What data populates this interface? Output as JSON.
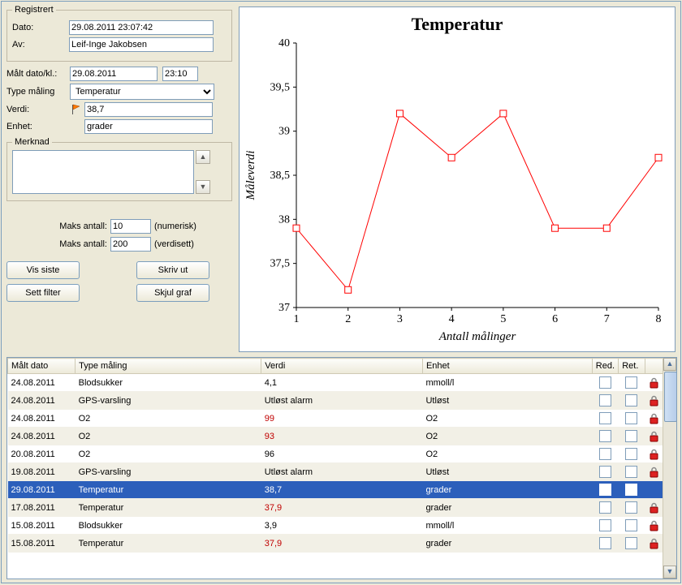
{
  "registered": {
    "legend": "Registrert",
    "date_label": "Dato:",
    "date_value": "29.08.2011 23:07:42",
    "by_label": "Av:",
    "by_value": "Leif-Inge Jakobsen"
  },
  "measure_form": {
    "measured_label": "Målt dato/kl.:",
    "measured_date": "29.08.2011",
    "measured_time": "23:10",
    "type_label": "Type måling",
    "type_value": "Temperatur",
    "value_label": "Verdi:",
    "value": "38,7",
    "unit_label": "Enhet:",
    "unit_value": "grader",
    "note_legend": "Merknad",
    "note_value": ""
  },
  "limits": {
    "label": "Maks antall:",
    "numeric_value": "10",
    "numeric_suffix": "(numerisk)",
    "valueset_value": "200",
    "valueset_suffix": "(verdisett)"
  },
  "buttons": {
    "vis_siste": "Vis siste",
    "sett_filter": "Sett filter",
    "skriv_ut": "Skriv ut",
    "skjul_graf": "Skjul graf"
  },
  "chart_data": {
    "type": "line",
    "title": "Temperatur",
    "xlabel": "Antall målinger",
    "ylabel": "Måleverdi",
    "x": [
      1,
      2,
      3,
      4,
      5,
      6,
      7,
      8
    ],
    "values": [
      37.9,
      37.2,
      39.2,
      38.7,
      39.2,
      37.9,
      37.9,
      38.7
    ],
    "y_ticks": [
      37,
      37.5,
      38,
      38.5,
      39,
      39.5,
      40
    ],
    "y_tick_labels": [
      "37",
      "37,5",
      "38",
      "38,5",
      "39",
      "39,5",
      "40"
    ],
    "xlim": [
      1,
      8
    ],
    "ylim": [
      37,
      40
    ],
    "series_color": "#ff0000",
    "marker": "square-open"
  },
  "grid": {
    "columns": {
      "date": "Målt dato",
      "type": "Type måling",
      "value": "Verdi",
      "unit": "Enhet",
      "red": "Red.",
      "ret": "Ret."
    },
    "rows": [
      {
        "date": "24.08.2011",
        "type": "Blodsukker",
        "value": "4,1",
        "value_red": false,
        "unit": "mmoll/l",
        "selected": false,
        "locked": true
      },
      {
        "date": "24.08.2011",
        "type": "GPS-varsling",
        "value": "Utløst alarm",
        "value_red": false,
        "unit": "Utløst",
        "selected": false,
        "locked": true
      },
      {
        "date": "24.08.2011",
        "type": "O2",
        "value": "99",
        "value_red": true,
        "unit": "O2",
        "selected": false,
        "locked": true
      },
      {
        "date": "24.08.2011",
        "type": "O2",
        "value": "93",
        "value_red": true,
        "unit": "O2",
        "selected": false,
        "locked": true
      },
      {
        "date": "20.08.2011",
        "type": "O2",
        "value": "96",
        "value_red": false,
        "unit": "O2",
        "selected": false,
        "locked": true
      },
      {
        "date": "19.08.2011",
        "type": "GPS-varsling",
        "value": "Utløst alarm",
        "value_red": false,
        "unit": "Utløst",
        "selected": false,
        "locked": true
      },
      {
        "date": "29.08.2011",
        "type": "Temperatur",
        "value": "38,7",
        "value_red": false,
        "unit": "grader",
        "selected": true,
        "locked": false
      },
      {
        "date": "17.08.2011",
        "type": "Temperatur",
        "value": "37,9",
        "value_red": true,
        "unit": "grader",
        "selected": false,
        "locked": true
      },
      {
        "date": "15.08.2011",
        "type": "Blodsukker",
        "value": "3,9",
        "value_red": false,
        "unit": "mmoll/l",
        "selected": false,
        "locked": true
      },
      {
        "date": "15.08.2011",
        "type": "Temperatur",
        "value": "37,9",
        "value_red": true,
        "unit": "grader",
        "selected": false,
        "locked": true
      }
    ]
  }
}
